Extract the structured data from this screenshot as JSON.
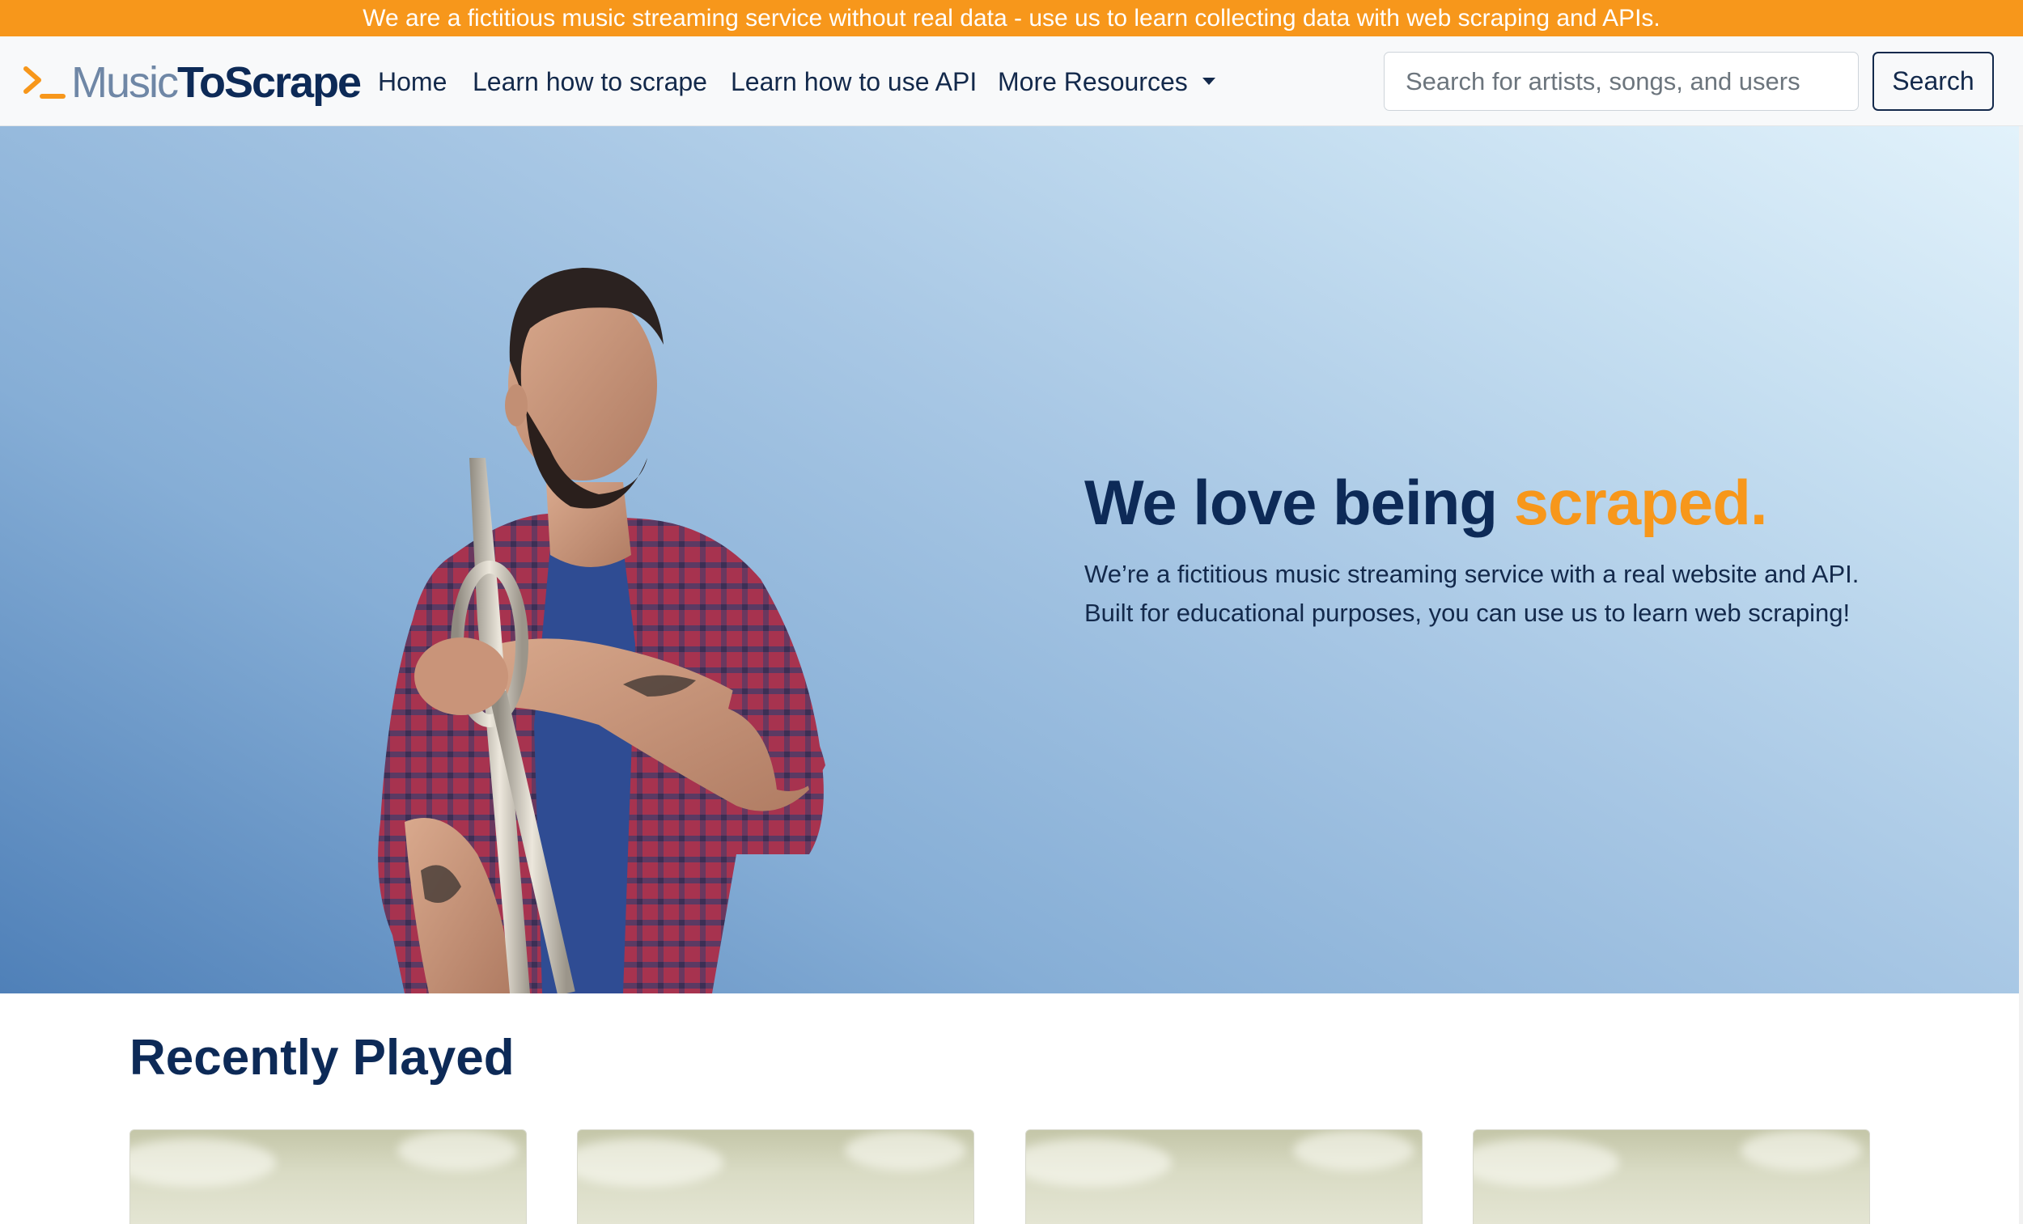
{
  "banner": {
    "text": "We are a fictitious music streaming service without real data - use us to learn collecting data with web scraping and APIs."
  },
  "navbar": {
    "logo": {
      "part1": "Music",
      "part2": "ToScrape"
    },
    "links": [
      {
        "label": "Home"
      },
      {
        "label": "Learn how to scrape"
      },
      {
        "label": "Learn how to use API"
      },
      {
        "label": "More Resources"
      }
    ],
    "search": {
      "placeholder": "Search for artists, songs, and users",
      "button_label": "Search"
    }
  },
  "hero": {
    "title_main": "We love being ",
    "title_accent": "scraped.",
    "subtitle_line1": "We’re a fictitious music streaming service with a real website and API.",
    "subtitle_line2": "Built for educational purposes, you can use us to learn web scraping!"
  },
  "recently_played": {
    "heading": "Recently Played",
    "cards": [
      {},
      {},
      {},
      {}
    ]
  },
  "colors": {
    "accent": "#f7971b",
    "navy": "#0d2a57"
  }
}
